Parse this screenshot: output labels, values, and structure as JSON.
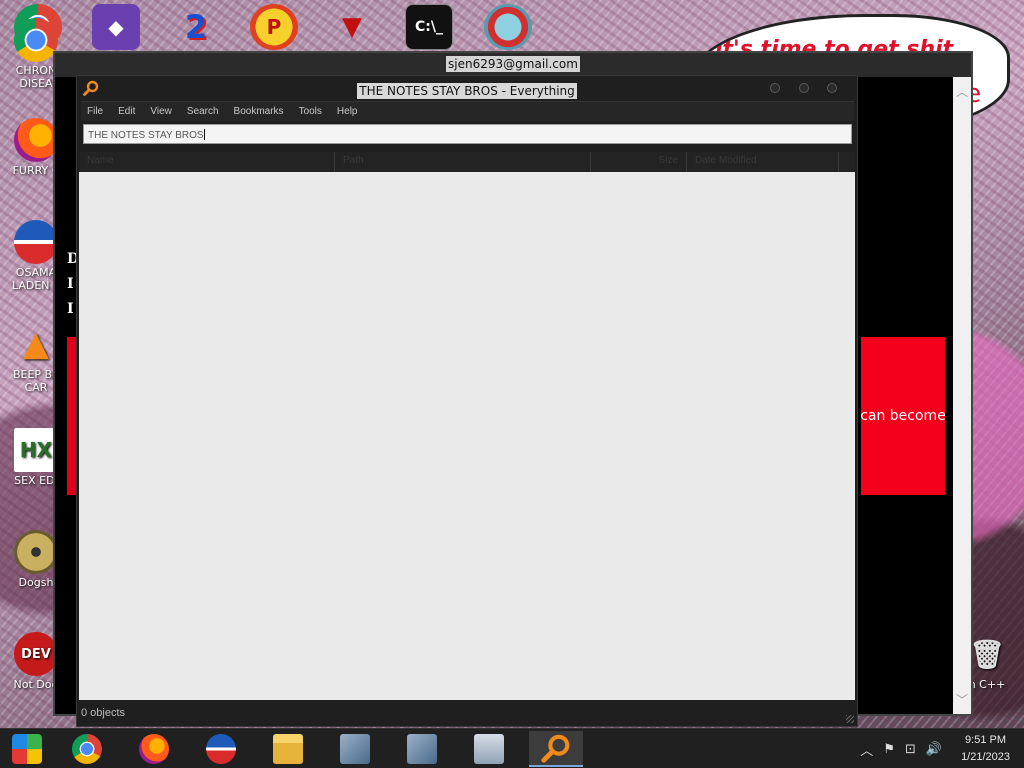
{
  "desktop": {
    "icons": [
      {
        "label": "CHRON DISEA",
        "icon": "chrome-icon"
      },
      {
        "label": "FURRY C",
        "icon": "firefox-icon"
      },
      {
        "label": "OSAMA LADEN E",
        "icon": "obama-logo-icon"
      },
      {
        "label": "BEEP BE CAR",
        "icon": "vlc-icon"
      },
      {
        "label": "SEX EDI",
        "icon": "hxd-icon"
      },
      {
        "label": "Dogsh",
        "icon": "disc-icon"
      },
      {
        "label": "Not Dog",
        "icon": "devcpp-icon"
      }
    ],
    "top_icons": [
      "chrome-icon",
      "visual-studio-icon",
      "number-two-icon",
      "p-logo-icon",
      "bat-logo-icon",
      "cmd-icon",
      "cartoon-icon"
    ],
    "speech_bubble": {
      "line": "it's time to get shit",
      "fragment": "te"
    },
    "recycle_label": "n C++"
  },
  "browser": {
    "title": "sjen6293@gmail.com",
    "side_letters": [
      "D",
      "I",
      "I"
    ],
    "red_box_text": "can become"
  },
  "app": {
    "title": "THE NOTES STAY BROS - Everything",
    "menu": [
      "File",
      "Edit",
      "View",
      "Search",
      "Bookmarks",
      "Tools",
      "Help"
    ],
    "search": {
      "value": "THE NOTES STAY BROS"
    },
    "columns": [
      "Name",
      "Path",
      "Size",
      "Date Modified"
    ],
    "status": "0 objects",
    "accent": "#f08a1c"
  },
  "taskbar": {
    "apps": [
      "windows-start-icon",
      "chrome-icon",
      "firefox-icon",
      "obama-logo-icon",
      "file-explorer-icon",
      "installer-icon",
      "installer-icon",
      "task-manager-icon",
      "everything-search-icon"
    ],
    "active": "everything-search-icon",
    "clock": {
      "time": "9:51 PM",
      "date": "1/21/2023"
    }
  }
}
